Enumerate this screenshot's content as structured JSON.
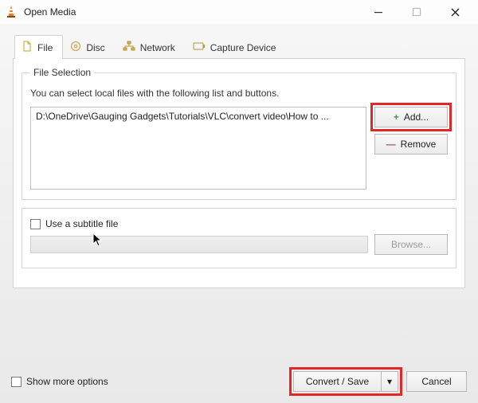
{
  "window": {
    "title": "Open Media"
  },
  "tabs": {
    "file": "File",
    "disc": "Disc",
    "network": "Network",
    "capture": "Capture Device"
  },
  "fileSelection": {
    "legend": "File Selection",
    "hint": "You can select local files with the following list and buttons.",
    "items": [
      "D:\\OneDrive\\Gauging Gadgets\\Tutorials\\VLC\\convert video\\How to ..."
    ],
    "add_label": "Add...",
    "remove_label": "Remove"
  },
  "subtitle": {
    "use_label": "Use a subtitle file",
    "browse_label": "Browse..."
  },
  "footer": {
    "show_more": "Show more options",
    "convert_label": "Convert / Save",
    "cancel_label": "Cancel"
  },
  "icons": {
    "plus": "+",
    "minus": "—",
    "dropdown": "▾"
  }
}
